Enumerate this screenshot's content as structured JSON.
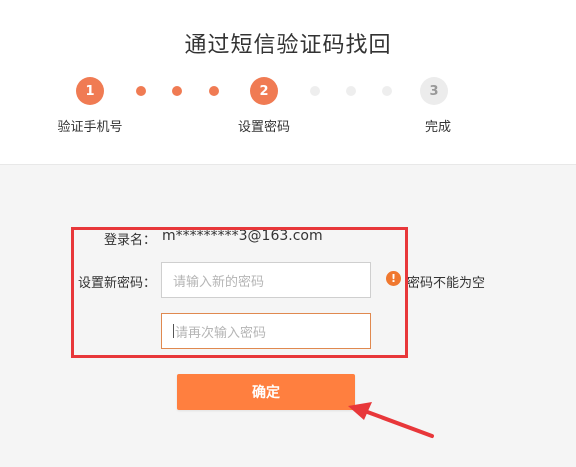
{
  "title": "通过短信验证码找回",
  "steps": [
    {
      "number": "1",
      "label": "验证手机号"
    },
    {
      "number": "2",
      "label": "设置密码"
    },
    {
      "number": "3",
      "label": "完成"
    }
  ],
  "form": {
    "username_label": "登录名：",
    "username_value": "m*********3@163.com",
    "new_password_label": "设置新密码：",
    "new_password_placeholder": "请输入新的密码",
    "confirm_password_placeholder": "请再次输入密码",
    "error_message": "密码不能为空",
    "error_icon": "warning-icon",
    "submit_label": "确定"
  },
  "colors": {
    "accent": "#f07b53",
    "button": "#ff7f3f",
    "annotation_red": "#e8373a",
    "error_icon": "#f0782f"
  }
}
